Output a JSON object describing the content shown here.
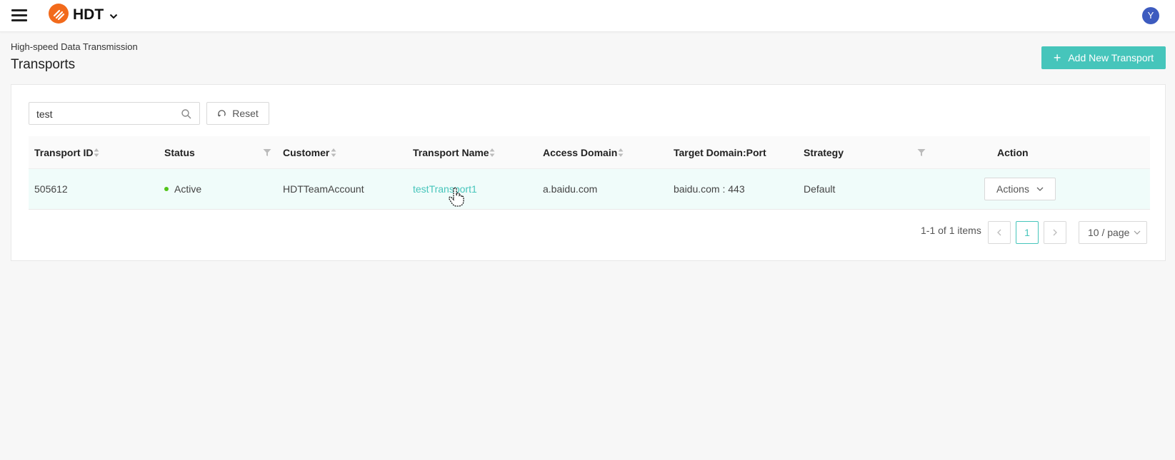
{
  "header": {
    "app_name": "HDT",
    "avatar_initial": "Y",
    "logo_color": "#f26a1b",
    "avatar_color": "#3d5bbf"
  },
  "page": {
    "breadcrumb": "High-speed Data Transmission",
    "title": "Transports",
    "add_button_label": "Add New Transport",
    "accent_color": "#46c5bb"
  },
  "filters": {
    "search_value": "test",
    "reset_label": "Reset"
  },
  "table": {
    "columns": [
      "Transport ID",
      "Status",
      "Customer",
      "Transport Name",
      "Access Domain",
      "Target Domain:Port",
      "Strategy",
      "Action"
    ],
    "rows": [
      {
        "transport_id": "505612",
        "status": "Active",
        "customer": "HDTTeamAccount",
        "transport_name": "testTransport1",
        "access_domain": "a.baidu.com",
        "target": "baidu.com : 443",
        "strategy": "Default",
        "action_label": "Actions"
      }
    ]
  },
  "pagination": {
    "total_text": "1-1 of 1 items",
    "current_page": "1",
    "page_size": "10 / page"
  }
}
